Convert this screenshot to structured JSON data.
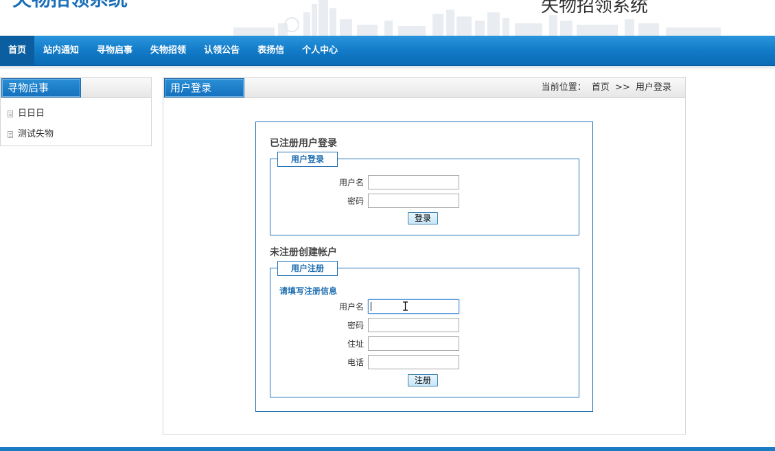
{
  "header": {
    "title_left": "失物招领系统",
    "title_right": "失物招领系统"
  },
  "nav": {
    "items": [
      {
        "label": "首页",
        "active": true
      },
      {
        "label": "站内通知"
      },
      {
        "label": "寻物启事"
      },
      {
        "label": "失物招领"
      },
      {
        "label": "认领公告"
      },
      {
        "label": "表扬信"
      },
      {
        "label": "个人中心"
      }
    ]
  },
  "sidebar": {
    "title": "寻物启事",
    "items": [
      {
        "label": "日日日"
      },
      {
        "label": "测试失物"
      }
    ]
  },
  "main": {
    "title": "用户登录",
    "breadcrumb": {
      "prefix": "当前位置：",
      "home": "首页",
      "separator": ">>",
      "current": "用户登录"
    },
    "login": {
      "section_title": "已注册用户登录",
      "legend": "用户登录",
      "username_label": "用户名",
      "username_value": "",
      "password_label": "密码",
      "password_value": "",
      "submit_label": "登录"
    },
    "register": {
      "section_title": "未注册创建帐户",
      "legend": "用户注册",
      "hint": "请填写注册信息",
      "username_label": "用户名",
      "username_value": "",
      "password_label": "密码",
      "password_value": "",
      "address_label": "住址",
      "address_value": "",
      "phone_label": "电话",
      "phone_value": "",
      "submit_label": "注册"
    }
  },
  "colors": {
    "nav_blue": "#1179c6",
    "border_blue": "#1f6fb2",
    "title_blue": "#1a6fb8"
  }
}
